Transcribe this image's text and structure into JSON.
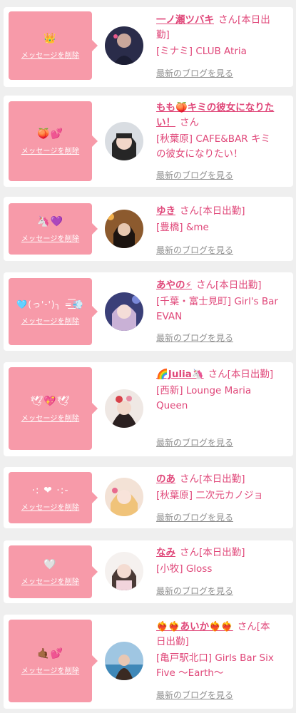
{
  "delete_label": "メッセージを削除",
  "blog_label": "最新のブログを見る",
  "colors": {
    "background": "#efefef",
    "card": "#ffffff",
    "bubble": "#f79aa9",
    "accent": "#e0487a",
    "link_gray": "#8f8f8f"
  },
  "messages": [
    {
      "emoji": "👑",
      "name": "一ノ瀬ツバキ",
      "suffix": "さん[本日出勤]",
      "shop": "[ミナミ] CLUB Atria"
    },
    {
      "emoji": "🍑💕",
      "name": "もも🍑キミの彼女になりたい！",
      "suffix": "さん",
      "shop": "[秋葉原] CAFE&BAR キミの彼女になりたい！"
    },
    {
      "emoji": "🦄💜",
      "name": "ゆき",
      "suffix": "さん[本日出勤]",
      "shop": "[豊橋] &me"
    },
    {
      "emoji": "🩵(っ'-')╮ =͟͟͞͞💨",
      "name": "あやの⚡",
      "suffix": "さん[本日出勤]",
      "shop": "[千葉・富士見町] Girl's Bar EVAN"
    },
    {
      "emoji": "🕊💖🕊",
      "name": "🌈Julia🦄",
      "suffix": "さん[本日出勤]",
      "shop": "[西新] Lounge Maria Queen"
    },
    {
      "emoji": "·: ❤ ·:-",
      "name": "のあ",
      "suffix": "さん[本日出勤]",
      "shop": "[秋葉原] 二次元カノジョ"
    },
    {
      "emoji": "🤍",
      "name": "なみ",
      "suffix": "さん[本日出勤]",
      "shop": "[小牧] Gloss"
    },
    {
      "emoji": "🤙🏾💕",
      "name": "❤️‍🔥❤️‍🔥あいか❤️‍🔥❤️‍🔥",
      "suffix": "さん[本日出勤]",
      "shop": "[亀戸駅北口] Girls Bar Six Five 〜Earth〜"
    }
  ]
}
